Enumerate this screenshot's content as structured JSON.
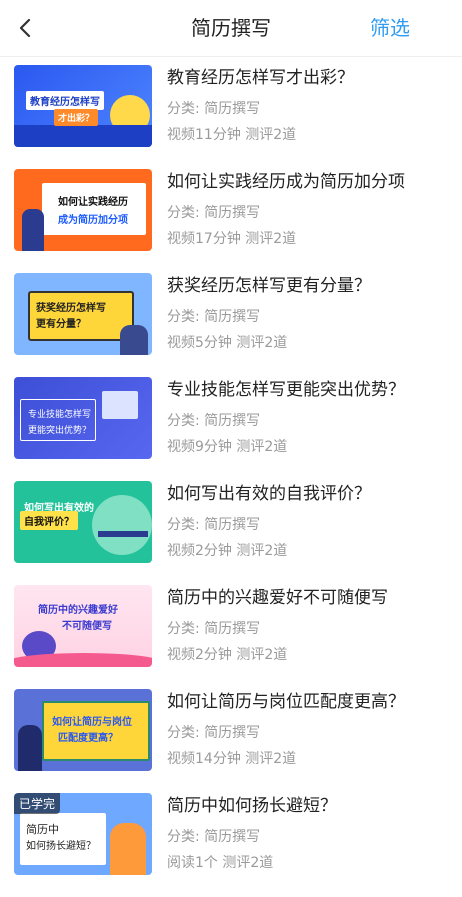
{
  "header": {
    "title": "简历撰写",
    "filter_label": "筛选"
  },
  "items": [
    {
      "title": "教育经历怎样写才出彩？",
      "category": "分类: 简历撰写",
      "stats": "视频11分钟  测评2道",
      "thumb_text": "教育经历怎样写",
      "thumb_sub": "才出彩？"
    },
    {
      "title": "如何让实践经历成为简历加分项",
      "category": "分类: 简历撰写",
      "stats": "视频17分钟  测评2道",
      "thumb_text": "如何让实践经历",
      "thumb_sub": "成为简历加分项"
    },
    {
      "title": "获奖经历怎样写更有分量？",
      "category": "分类: 简历撰写",
      "stats": "视频5分钟  测评2道",
      "thumb_text": "获奖经历怎样写",
      "thumb_sub": "更有分量？"
    },
    {
      "title": "专业技能怎样写更能突出优势？",
      "category": "分类: 简历撰写",
      "stats": "视频9分钟  测评2道",
      "thumb_text": "专业技能怎样写",
      "thumb_sub": "更能突出优势？"
    },
    {
      "title": "如何写出有效的自我评价？",
      "category": "分类: 简历撰写",
      "stats": "视频2分钟  测评2道",
      "thumb_text": "如何写出有效的",
      "thumb_sub": "自我评价？"
    },
    {
      "title": "简历中的兴趣爱好不可随便写",
      "category": "分类: 简历撰写",
      "stats": "视频2分钟  测评2道",
      "thumb_text": "简历中的兴趣爱好",
      "thumb_sub": "不可随便写"
    },
    {
      "title": "如何让简历与岗位匹配度更高？",
      "category": "分类: 简历撰写",
      "stats": "视频14分钟  测评2道",
      "thumb_text": "如何让简历与岗位",
      "thumb_sub": "匹配度更高？"
    },
    {
      "title": "简历中如何扬长避短？",
      "category": "分类: 简历撰写",
      "stats": "阅读1个  测评2道",
      "thumb_text": "简历中",
      "thumb_sub": "如何扬长避短？",
      "badge": "已学完"
    }
  ],
  "colors": {
    "accent": "#2f9cf2",
    "meta": "#9a9a9a"
  }
}
